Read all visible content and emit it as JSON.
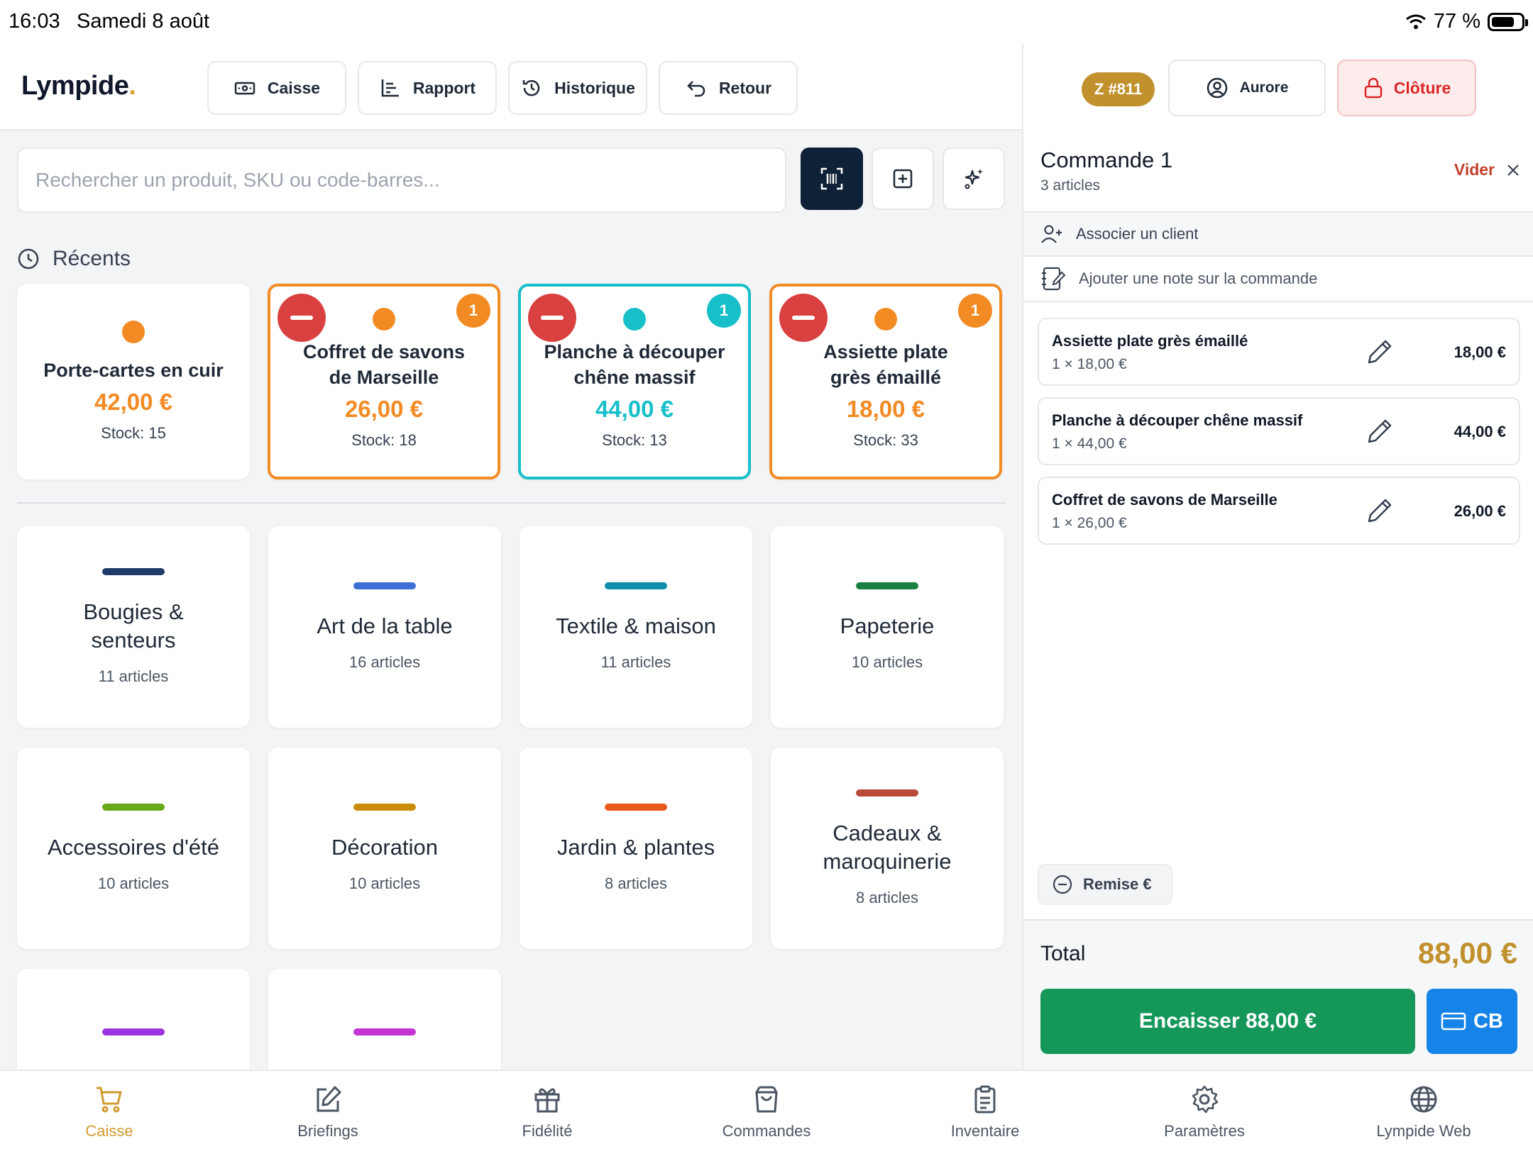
{
  "status_bar": {
    "time": "16:03",
    "date": "Samedi 8 août",
    "battery": "77 %",
    "battery_level": 0.77
  },
  "app": {
    "logo": "Lympide",
    "logo_dot": "."
  },
  "nav": [
    {
      "label": "Caisse",
      "icon": "cash-icon"
    },
    {
      "label": "Rapport",
      "icon": "chart-icon"
    },
    {
      "label": "Historique",
      "icon": "history-icon"
    },
    {
      "label": "Retour",
      "icon": "return-icon"
    }
  ],
  "session": {
    "z_badge": "Z #811",
    "user": "Aurore",
    "cloture": "Clôture"
  },
  "search": {
    "placeholder": "Rechercher un produit, SKU ou code-barres..."
  },
  "recents": {
    "title": "Récents",
    "items": [
      {
        "name": "Porte-cartes en cuir",
        "price": "42,00 €",
        "stock": "Stock: 15",
        "color": "#f28b24",
        "count": ""
      },
      {
        "name": "Coffret de savons de Marseille",
        "price": "26,00 €",
        "stock": "Stock: 18",
        "color": "#f28b24",
        "count": "1"
      },
      {
        "name": "Planche à découper chêne massif",
        "price": "44,00 €",
        "stock": "Stock: 13",
        "color": "#17bfc9",
        "count": "1"
      },
      {
        "name": "Assiette plate grès émaillé",
        "price": "18,00 €",
        "stock": "Stock: 33",
        "color": "#f28b24",
        "count": "1"
      }
    ]
  },
  "categories": [
    {
      "name": "Bougies & senteurs",
      "count": "11 articles",
      "color": "#1e3a66"
    },
    {
      "name": "Art de la table",
      "count": "16 articles",
      "color": "#3b6fd6"
    },
    {
      "name": "Textile & maison",
      "count": "11 articles",
      "color": "#0e8ea8"
    },
    {
      "name": "Papeterie",
      "count": "10 articles",
      "color": "#198042"
    },
    {
      "name": "Accessoires d'été",
      "count": "10 articles",
      "color": "#68a918"
    },
    {
      "name": "Décoration",
      "count": "10 articles",
      "color": "#c98d0b"
    },
    {
      "name": "Jardin & plantes",
      "count": "8 articles",
      "color": "#e8591a"
    },
    {
      "name": "Cadeaux & maroquinerie",
      "count": "8 articles",
      "color": "#b94a3a"
    },
    {
      "name": "",
      "count": "",
      "color": "#9b35e0"
    },
    {
      "name": "",
      "count": "",
      "color": "#c334d3"
    }
  ],
  "order": {
    "title": "Commande 1",
    "subtitle": "3 articles",
    "clear": "Vider",
    "client": "Associer un client",
    "note": "Ajouter une note sur la commande",
    "lines": [
      {
        "name": "Assiette plate grès émaillé",
        "qty": "1 × 18,00 €",
        "price": "18,00 €"
      },
      {
        "name": "Planche à découper chêne massif",
        "qty": "1 × 44,00 €",
        "price": "44,00 €"
      },
      {
        "name": "Coffret de savons de Marseille",
        "qty": "1 × 26,00 €",
        "price": "26,00 €"
      }
    ],
    "discount": "Remise €",
    "total_label": "Total",
    "total": "88,00 €",
    "pay": "Encaisser 88,00 €",
    "card": "CB"
  },
  "tabs": [
    {
      "label": "Caisse",
      "icon": "cart-icon",
      "active": true
    },
    {
      "label": "Briefings",
      "icon": "edit-icon",
      "active": false
    },
    {
      "label": "Fidélité",
      "icon": "gift-icon",
      "active": false
    },
    {
      "label": "Commandes",
      "icon": "bag-icon",
      "active": false
    },
    {
      "label": "Inventaire",
      "icon": "clipboard-icon",
      "active": false
    },
    {
      "label": "Paramètres",
      "icon": "gear-icon",
      "active": false
    },
    {
      "label": "Lympide Web",
      "icon": "globe-icon",
      "active": false
    }
  ],
  "colors": {
    "accent_gold": "#c1912d",
    "pay_green": "#16975a",
    "card_blue": "#1583e8",
    "danger": "#d94141",
    "dark_navy": "#0f2137"
  }
}
